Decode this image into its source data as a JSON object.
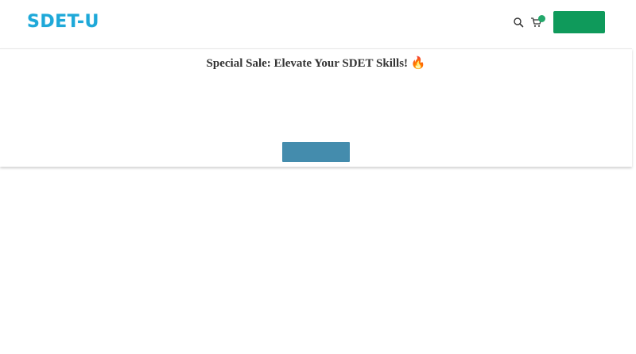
{
  "header": {
    "logo_text": "SDET-U",
    "search_icon": "search-icon",
    "cart_icon": "cart-icon",
    "cta_label": "",
    "accent_color": "#0f9a5b"
  },
  "banner": {
    "title": "Special Sale: Elevate Your SDET Skills! 🔥",
    "button_label": "",
    "button_color": "#448cad"
  }
}
